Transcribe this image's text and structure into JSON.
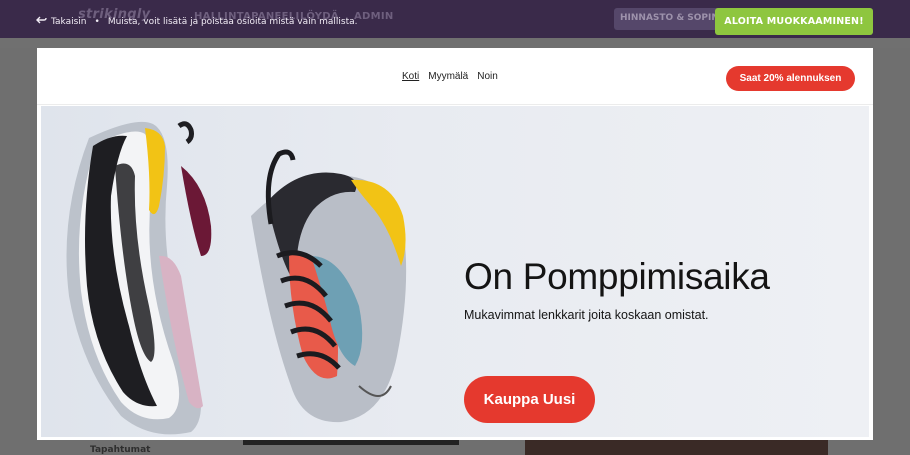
{
  "editor_bar": {
    "logo": "strikingly",
    "ghost_nav": [
      "HALLINTAPANEELI",
      "LÖYDÄ",
      "ADMIN"
    ],
    "pricing_ghost": "HINNASTO & SOPIMUKSET",
    "back_label": "Takaisin",
    "separator": "•",
    "hint": "Muista, voit lisätä ja poistaa osioita mistä vain mallista.",
    "start_button": "ALOITA MUOKKAAMINEN!"
  },
  "background_page": {
    "sidebar_label": "Tapahtumat"
  },
  "site": {
    "nav": [
      {
        "label": "Koti",
        "active": true
      },
      {
        "label": "Myymälä",
        "active": false
      },
      {
        "label": "Noin",
        "active": false
      }
    ],
    "promo_button": "Saat 20% alennuksen",
    "hero": {
      "title": "On Pomppimisaika",
      "subtitle": "Mukavimmat lenkkarit joita koskaan omistat.",
      "cta": "Kauppa Uusi"
    }
  },
  "colors": {
    "editor_bar": "#3a2a4a",
    "start_button": "#8ec63f",
    "accent_red": "#e5392e",
    "hero_background": "#e4e8ef"
  },
  "icons": {
    "back": "arrow-return-left-icon"
  }
}
